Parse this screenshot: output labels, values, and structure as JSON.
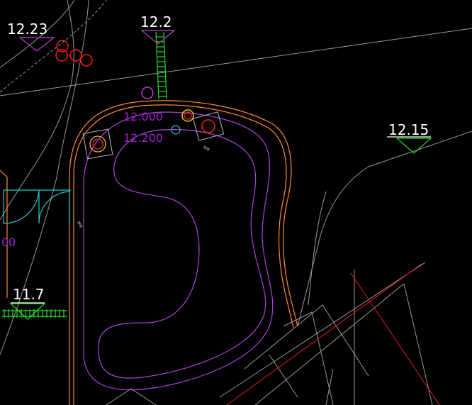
{
  "drawing": {
    "background": "#000000",
    "colors": {
      "elevation_text": "#ffffff",
      "contour_text": "#a020d0",
      "boundary": "#ff8c2e",
      "pool_edge": "#b040e0",
      "grid": "#9a9a9a",
      "red_line": "#e02020",
      "hatch": "#22dd22",
      "cyan": "#22cccc",
      "marker_red": "#ff1a1a"
    },
    "elevation_markers": [
      {
        "id": "em-1",
        "label": "12.23"
      },
      {
        "id": "em-2",
        "label": "12.2"
      },
      {
        "id": "em-3",
        "label": "12.15"
      },
      {
        "id": "em-4",
        "label": "11.7"
      }
    ],
    "contour_labels": [
      {
        "id": "cl-1",
        "label": "12.000"
      },
      {
        "id": "cl-2",
        "label": "12.200"
      },
      {
        "id": "cl-3",
        "label": "00"
      }
    ]
  }
}
